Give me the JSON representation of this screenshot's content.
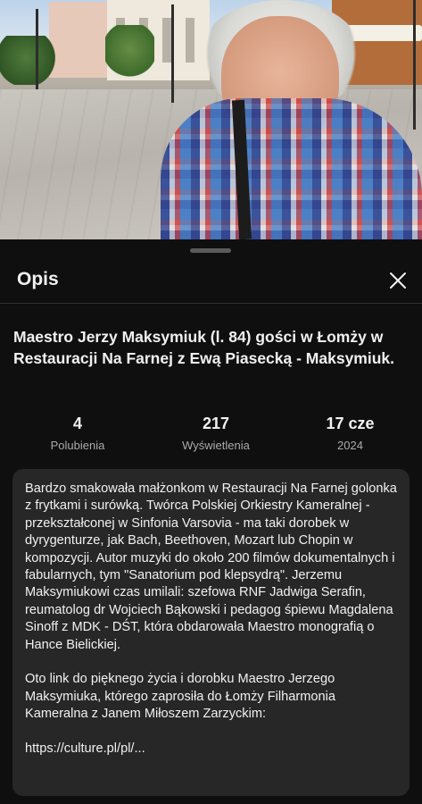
{
  "sheet": {
    "title": "Opis",
    "close_icon": "close-icon"
  },
  "video": {
    "title": "Maestro Jerzy Maksymiuk (l. 84) gości w Łomży w Restauracji Na Farnej z  Ewą Piasecką - Maksymiuk."
  },
  "stats": {
    "likes": {
      "value": "4",
      "label": "Polubienia"
    },
    "views": {
      "value": "217",
      "label": "Wyświetlenia"
    },
    "date": {
      "value": "17 cze",
      "label": "2024"
    }
  },
  "description": {
    "paragraph1": "Bardzo smakowała małżonkom w Restauracji Na Farnej golonka z frytkami i surówką. Twórca Polskiej Orkiestry Kameralnej - przekształconej w Sinfonia Varsovia - ma taki dorobek w dyrygenturze, jak Bach, Beethoven, Mozart lub Chopin w kompozycji. Autor muzyki do około 200 filmów dokumentalnych i fabularnych,  tym \"Sanatorium pod klepsydrą\". Jerzemu Maksymiukowi czas umilali: szefowa RNF Jadwiga Serafin, reumatolog dr Wojciech Bąkowski i pedagog śpiewu Magdalena Sinoff z MDK - DŚT, która obdarowała Maestro monografią o Hance Bielickiej.",
    "paragraph2": "Oto link do pięknego życia i dorobku Maestro Jerzego Maksymiuka, którego zaprosiła do Łomży Filharmonia Kameralna z Janem Miłoszem Zarzyckim:",
    "link": "https://culture.pl/pl/..."
  }
}
